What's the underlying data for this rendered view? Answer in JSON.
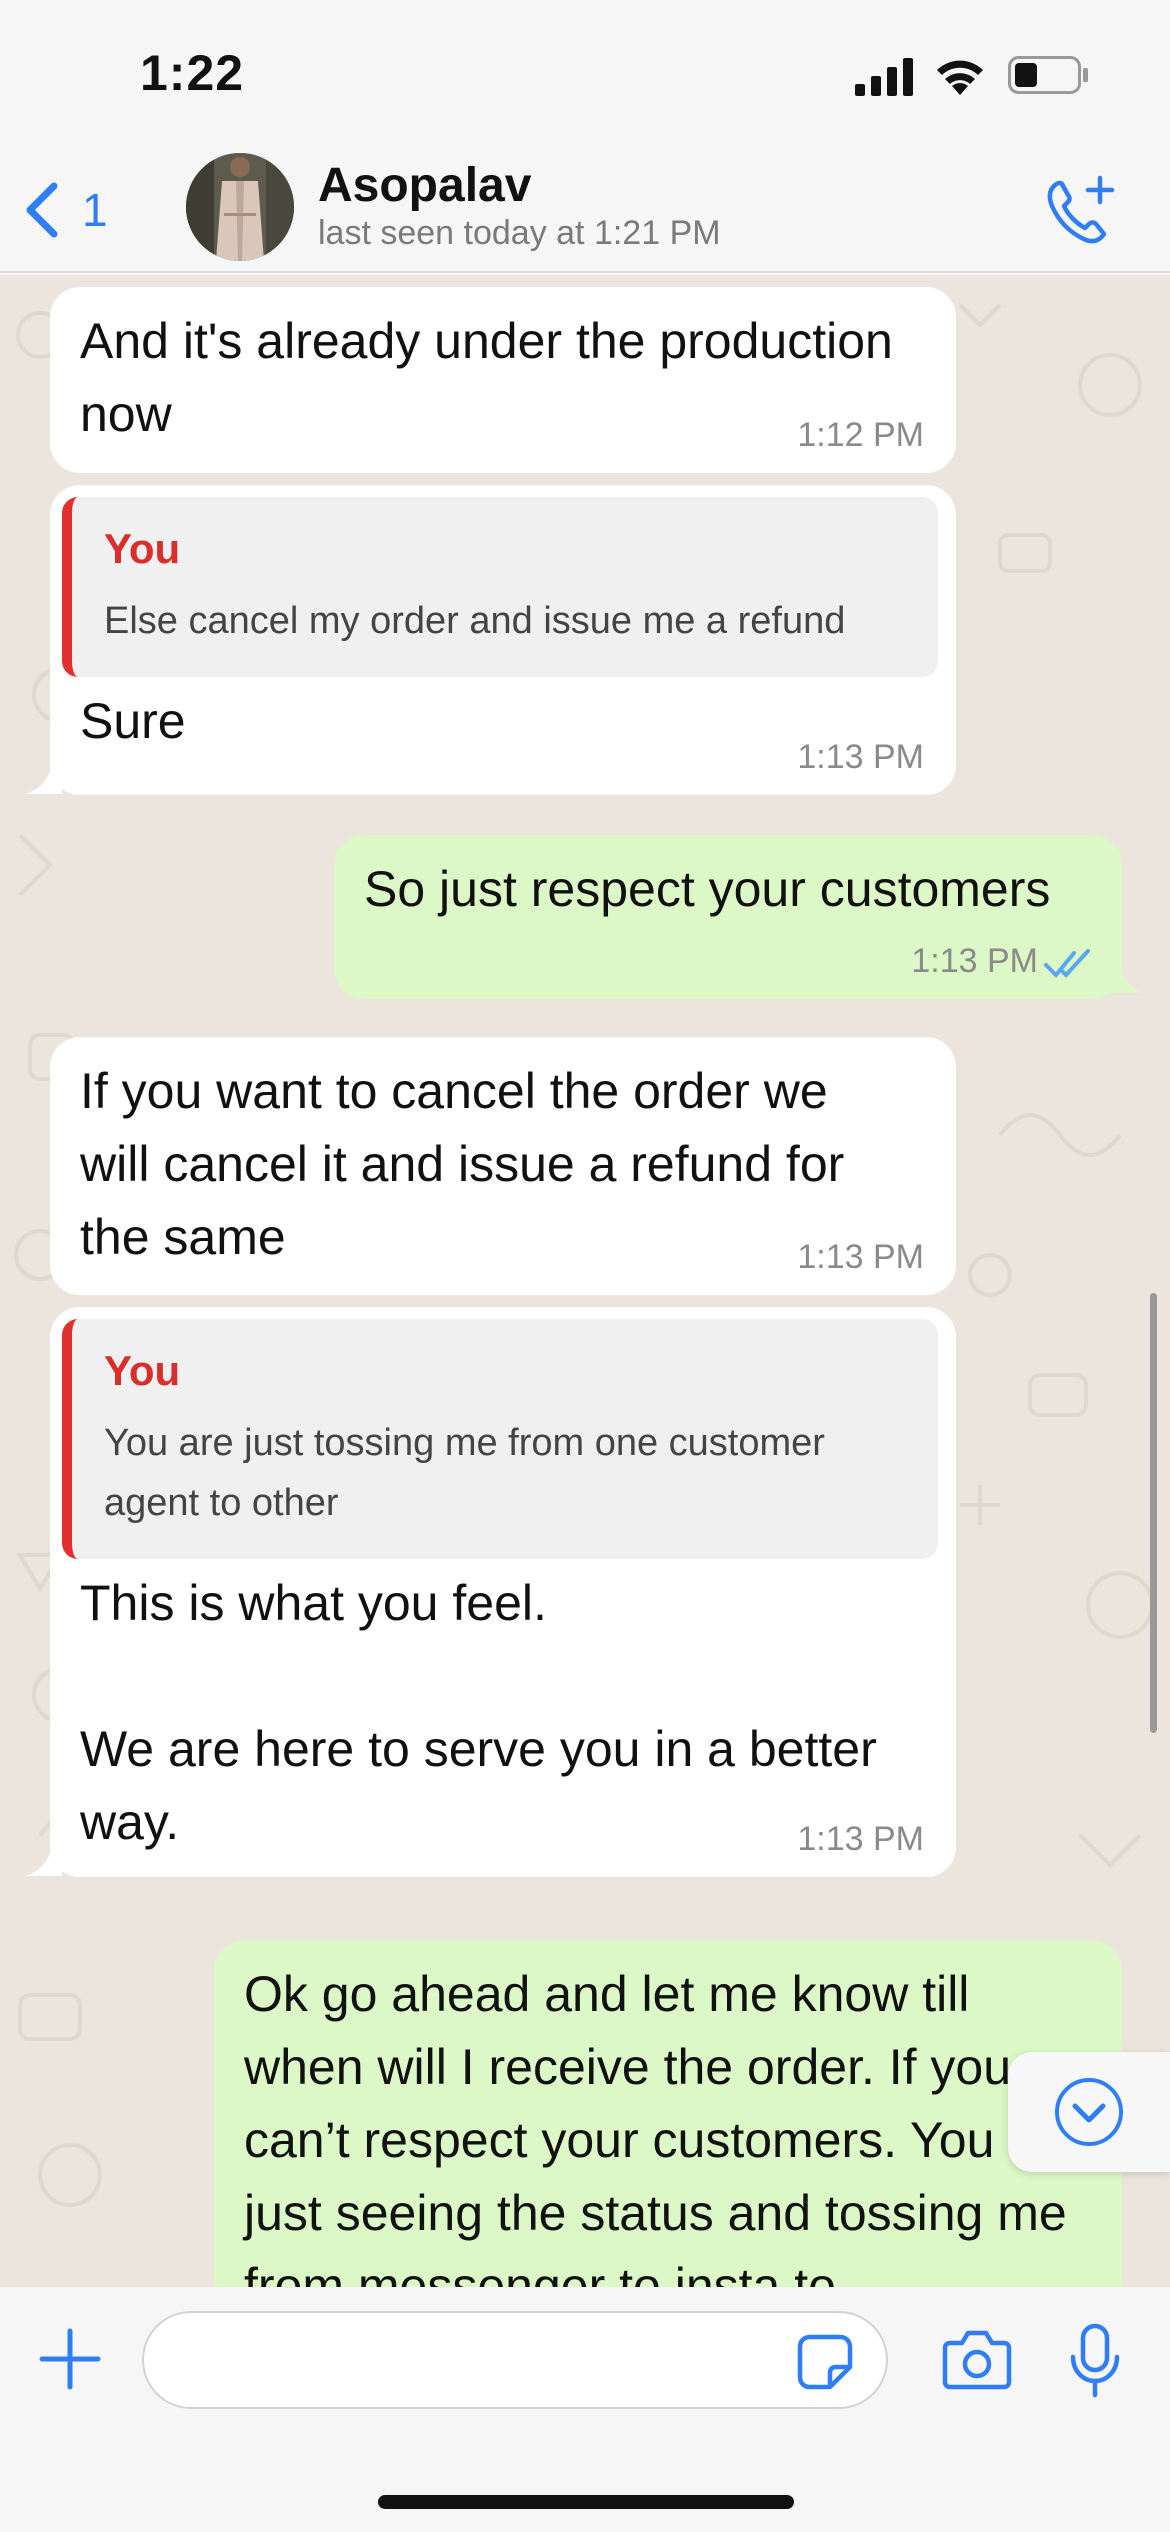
{
  "status_bar": {
    "time": "1:22"
  },
  "header": {
    "back_count": "1",
    "contact_name": "Asopalav",
    "contact_status": "last seen today at 1:21 PM"
  },
  "messages": [
    {
      "direction": "in",
      "text": "And it's already under the production now",
      "time": "1:12 PM"
    },
    {
      "direction": "in",
      "quote_author": "You",
      "quote_text": "Else cancel my order and issue me a refund",
      "text": "Sure",
      "time": "1:13 PM"
    },
    {
      "direction": "out",
      "text": "So just respect your customers",
      "time": "1:13 PM",
      "status": "read"
    },
    {
      "direction": "in",
      "text": "If you want to cancel the order we will cancel it and issue a refund for the same",
      "time": "1:13 PM"
    },
    {
      "direction": "in",
      "quote_author": "You",
      "quote_text": "You are just tossing me from one customer agent to other",
      "text": "This is what you feel.\n\nWe are here to serve you in a better way.",
      "time": "1:13 PM"
    },
    {
      "direction": "out",
      "text": "Ok go ahead and let me know till when will I receive the order. If you can’t respect your customers. You are just seeing the status and tossing me from messenger to insta to"
    }
  ],
  "composer": {
    "placeholder": ""
  },
  "colors": {
    "accent": "#2f7ef6",
    "incoming_bubble": "#ffffff",
    "outgoing_bubble": "#dcf8c6",
    "quote_bar": "#e0302f",
    "read_ticks": "#5aa6f5",
    "chat_background": "#ece5dd"
  },
  "icons": {
    "back": "chevron-left-icon",
    "call": "phone-plus-icon",
    "scroll_down": "chevron-down-circle-icon",
    "attach": "plus-icon",
    "sticker": "sticker-icon",
    "camera": "camera-icon",
    "mic": "microphone-icon"
  }
}
